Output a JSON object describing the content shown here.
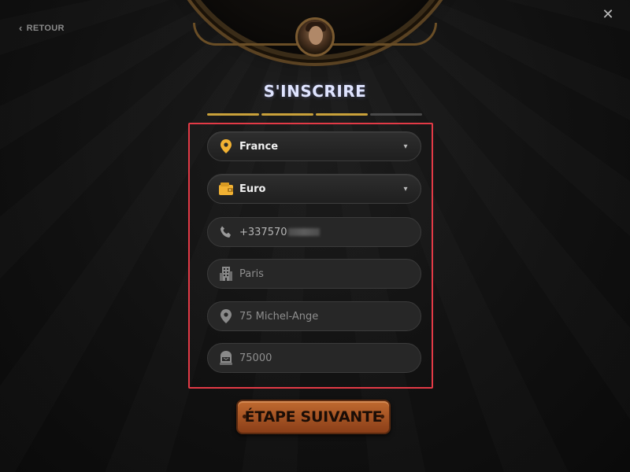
{
  "nav": {
    "back_label": "RETOUR",
    "close_symbol": "✕"
  },
  "title": "S'INSCRIRE",
  "progress": {
    "current_step": 3,
    "total_steps": 4
  },
  "form": {
    "country": {
      "value": "France",
      "icon": "location-pin-icon"
    },
    "currency": {
      "value": "Euro",
      "icon": "wallet-icon"
    },
    "phone": {
      "value": "+337570",
      "icon": "phone-icon"
    },
    "city": {
      "value": "Paris",
      "icon": "building-icon"
    },
    "address": {
      "value": "75 Michel-Ange",
      "icon": "location-pin-icon"
    },
    "postal_code": {
      "value": "75000",
      "icon": "mailbox-icon"
    }
  },
  "next_button_label": "ÉTAPE SUIVANTE",
  "colors": {
    "accent_gold": "#c9a13a",
    "highlight_border": "#e33a46",
    "button_orange": "#b0602a"
  }
}
